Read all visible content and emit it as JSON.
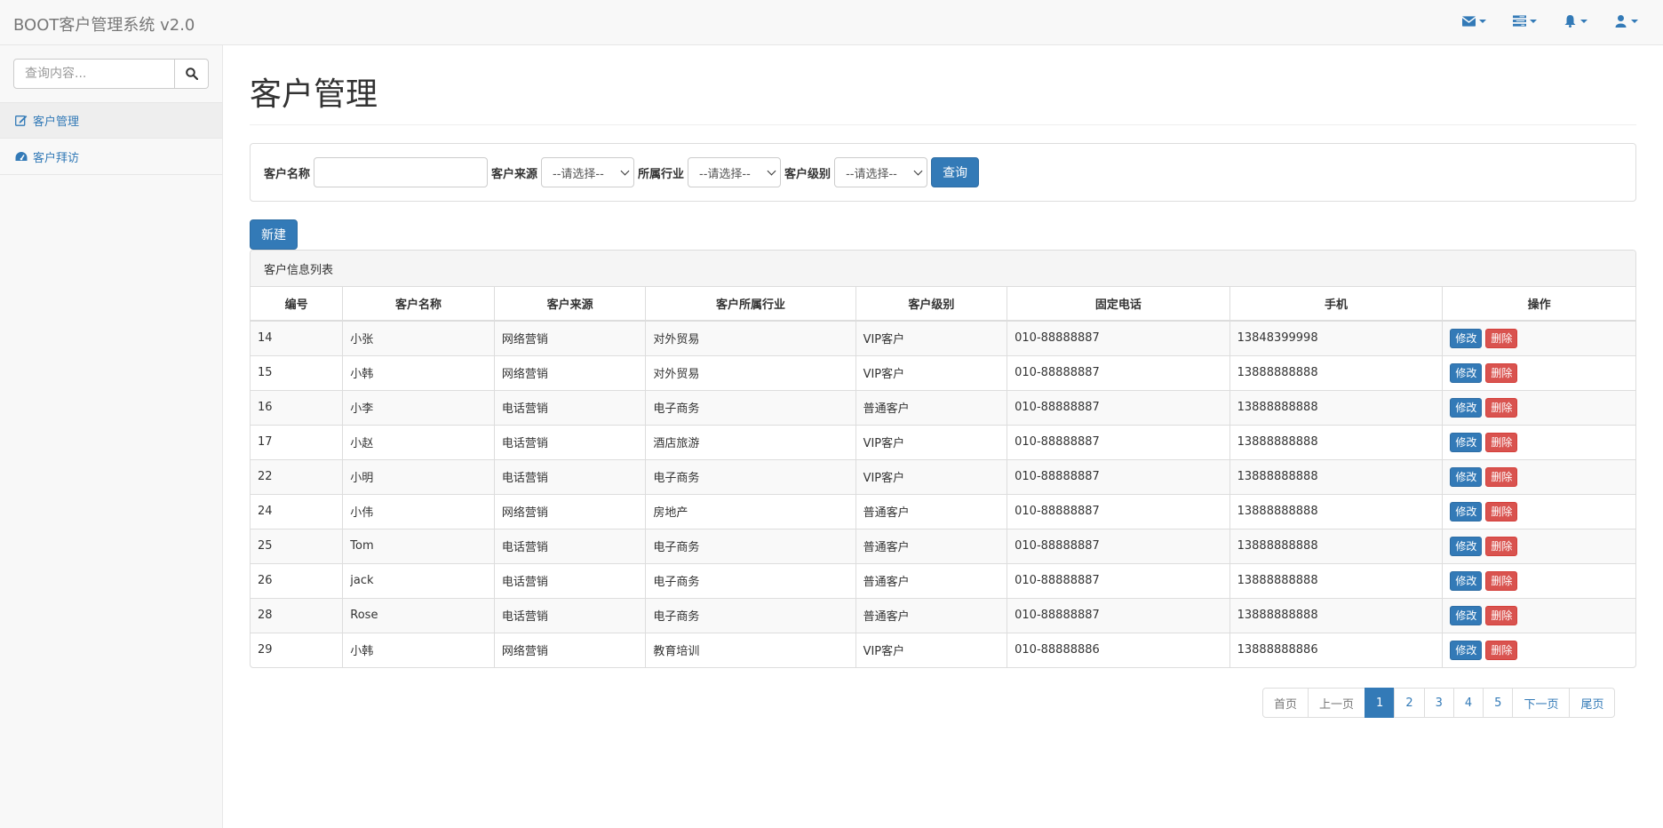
{
  "app": {
    "brand": "BOOT客户管理系统 v2.0"
  },
  "navbar": {
    "icons": [
      "envelope-icon",
      "tasks-icon",
      "bell-icon",
      "user-icon"
    ]
  },
  "sidebar": {
    "search_placeholder": "查询内容...",
    "items": [
      {
        "label": "客户管理",
        "icon": "edit-icon",
        "active": true
      },
      {
        "label": "客户拜访",
        "icon": "dashboard-icon",
        "active": false
      }
    ]
  },
  "page": {
    "title": "客户管理"
  },
  "filter": {
    "name_label": "客户名称",
    "name_value": "",
    "source_label": "客户来源",
    "source_selected": "--请选择--",
    "industry_label": "所属行业",
    "industry_selected": "--请选择--",
    "level_label": "客户级别",
    "level_selected": "--请选择--",
    "query_label": "查询"
  },
  "toolbar": {
    "new_label": "新建"
  },
  "list": {
    "heading": "客户信息列表",
    "columns": [
      "编号",
      "客户名称",
      "客户来源",
      "客户所属行业",
      "客户级别",
      "固定电话",
      "手机",
      "操作"
    ],
    "edit_label": "修改",
    "delete_label": "删除",
    "rows": [
      [
        "14",
        "小张",
        "网络营销",
        "对外贸易",
        "VIP客户",
        "010-88888887",
        "13848399998"
      ],
      [
        "15",
        "小韩",
        "网络营销",
        "对外贸易",
        "VIP客户",
        "010-88888887",
        "13888888888"
      ],
      [
        "16",
        "小李",
        "电话营销",
        "电子商务",
        "普通客户",
        "010-88888887",
        "13888888888"
      ],
      [
        "17",
        "小赵",
        "电话营销",
        "酒店旅游",
        "VIP客户",
        "010-88888887",
        "13888888888"
      ],
      [
        "22",
        "小明",
        "电话营销",
        "电子商务",
        "VIP客户",
        "010-88888887",
        "13888888888"
      ],
      [
        "24",
        "小伟",
        "网络营销",
        "房地产",
        "普通客户",
        "010-88888887",
        "13888888888"
      ],
      [
        "25",
        "Tom",
        "电话营销",
        "电子商务",
        "普通客户",
        "010-88888887",
        "13888888888"
      ],
      [
        "26",
        "jack",
        "电话营销",
        "电子商务",
        "普通客户",
        "010-88888887",
        "13888888888"
      ],
      [
        "28",
        "Rose",
        "电话营销",
        "电子商务",
        "普通客户",
        "010-88888887",
        "13888888888"
      ],
      [
        "29",
        "小韩",
        "网络营销",
        "教育培训",
        "VIP客户",
        "010-88888886",
        "13888888886"
      ]
    ]
  },
  "pagination": {
    "first": "首页",
    "prev": "上一页",
    "pages": [
      "1",
      "2",
      "3",
      "4",
      "5"
    ],
    "current": "1",
    "next": "下一页",
    "last": "尾页"
  },
  "colors": {
    "primary": "#337ab7",
    "danger": "#d9534f"
  }
}
